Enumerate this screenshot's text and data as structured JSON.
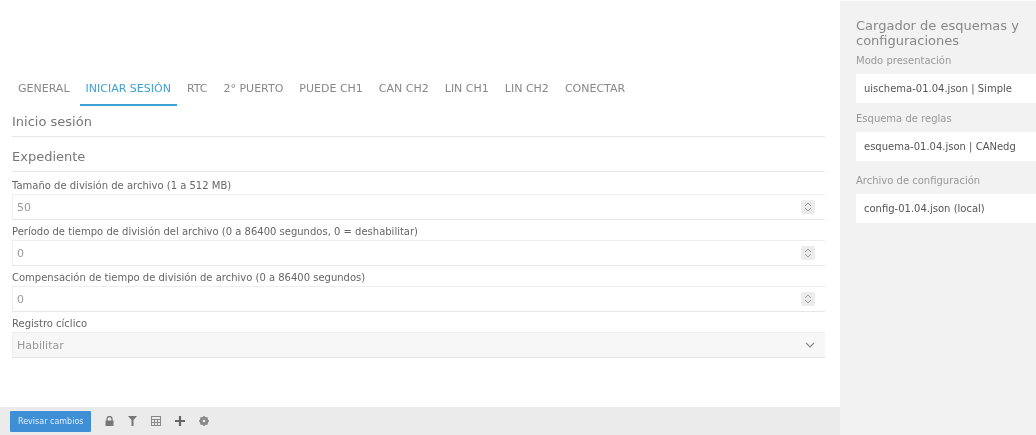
{
  "tabs": [
    {
      "label": "GENERAL",
      "selected": false
    },
    {
      "label": "INICIAR SESIÓN",
      "selected": true
    },
    {
      "label": "RTC",
      "selected": false
    },
    {
      "label": "2° PUERTO",
      "selected": false
    },
    {
      "label": "PUEDE CH1",
      "selected": false
    },
    {
      "label": "CAN CH2",
      "selected": false
    },
    {
      "label": "LIN CH1",
      "selected": false
    },
    {
      "label": "LIN CH2",
      "selected": false
    },
    {
      "label": "CONECTAR",
      "selected": false
    }
  ],
  "headings": [
    "Inicio sesión",
    "Expediente"
  ],
  "fields": [
    {
      "kind": "number",
      "label": "Tamaño de división de archivo (1 a 512 MB)",
      "value": "50"
    },
    {
      "kind": "number",
      "label": "Período de tiempo de división del archivo (0 a 86400 segundos, 0 = deshabilitar)",
      "value": "0"
    },
    {
      "kind": "number",
      "label": "Compensación de tiempo de división de archivo (0 a 86400 segundos)",
      "value": "0"
    },
    {
      "kind": "select",
      "label": "Registro cíclico",
      "value": "Habilitar"
    }
  ],
  "toolbar": {
    "button": "Revisar cambios"
  },
  "sidebar": {
    "title": "Cargador de esquemas y configuraciones",
    "fields": [
      {
        "label": "Modo presentación",
        "value": "uischema-01.04.json | Simple"
      },
      {
        "label": "Esquema de reglas",
        "value": "esquema-01.04.json | CANedg"
      },
      {
        "label": "Archivo de configuración",
        "value": "config-01.04.json (local)"
      }
    ]
  }
}
